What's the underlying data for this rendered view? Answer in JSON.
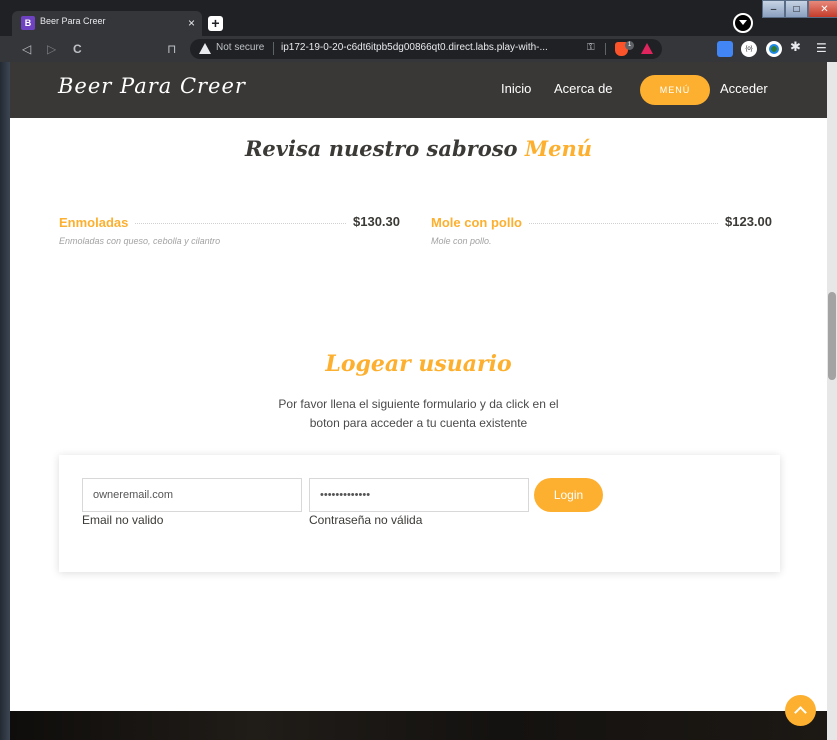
{
  "browser": {
    "tab_favicon_letter": "B",
    "tab_title": "Beer Para Creer",
    "tab_close": "×",
    "new_tab": "+",
    "nav_back": "◁",
    "nav_forward": "▷",
    "nav_reload": "C",
    "bookmark": "⊓",
    "security_label": "Not secure",
    "url": "ip172-19-0-20-c6dt6itpb5dg00866qt0.direct.labs.play-with-...",
    "brave_badge": "1",
    "ext_label": "{o}",
    "win_min": "–",
    "win_max": "□",
    "win_close": "✕",
    "puzzle": "✱",
    "menu": "☰"
  },
  "site": {
    "brand": "Beer Para Creer",
    "nav": {
      "inicio": "Inicio",
      "acerca": "Acerca de",
      "menu": "MENÚ",
      "acceder": "Acceder"
    },
    "accent_color": "#fdb02f",
    "header_color": "#3a3836"
  },
  "menu_section": {
    "heading_prefix": "Revisa nuestro sabroso",
    "heading_accent": "Menú",
    "items": [
      {
        "name": "Enmoladas",
        "price": "$130.30",
        "description": "Enmoladas con queso, cebolla y cilantro"
      },
      {
        "name": "Mole con pollo",
        "price": "$123.00",
        "description": "Mole con pollo."
      }
    ]
  },
  "login_section": {
    "heading": "Logear usuario",
    "subtitle_line1": "Por favor llena el siguiente formulario y da click en el",
    "subtitle_line2": "boton para acceder a tu cuenta existente",
    "email_value": "owneremail.com",
    "password_value": "•••••••••••••",
    "login_button": "Login",
    "email_error": "Email no valido",
    "password_error": "Contraseña no válida"
  }
}
